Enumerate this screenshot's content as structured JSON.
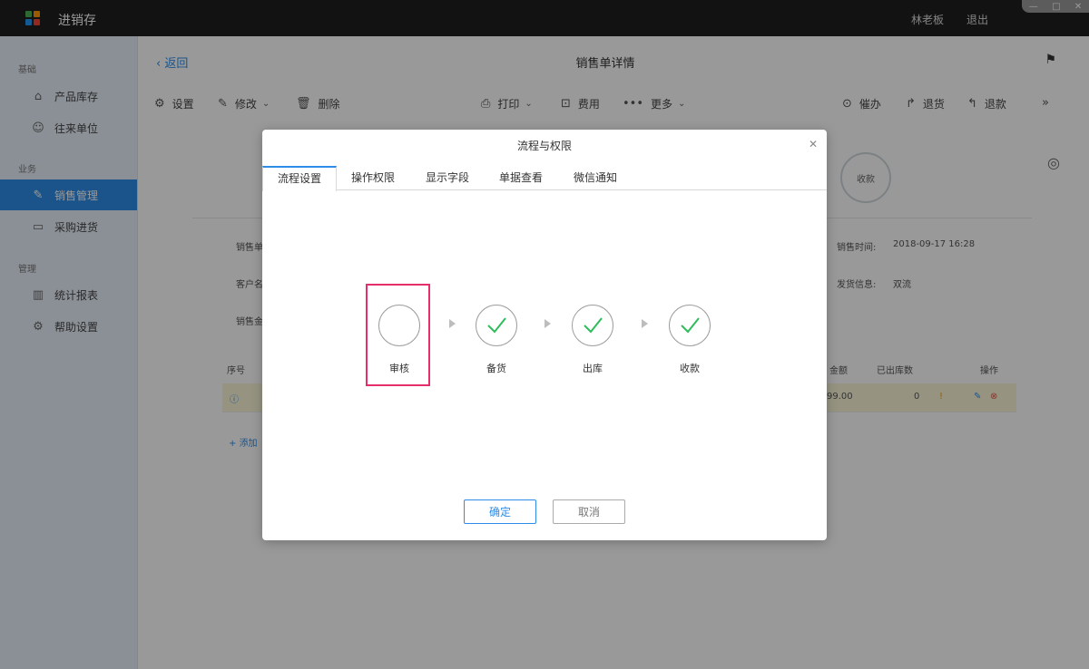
{
  "app": {
    "title": "进销存",
    "user": "林老板",
    "logout": "退出",
    "logo_colors": [
      "#4caf50",
      "#ff9800",
      "#2196f3",
      "#f44336"
    ]
  },
  "sidebar": {
    "sections": [
      {
        "label": "基础",
        "items": [
          {
            "label": "产品库存",
            "icon": "tag-icon"
          },
          {
            "label": "往来单位",
            "icon": "contacts-icon"
          }
        ]
      },
      {
        "label": "业务",
        "items": [
          {
            "label": "销售管理",
            "icon": "edit-icon",
            "active": true
          },
          {
            "label": "采购进货",
            "icon": "inbox-icon"
          }
        ]
      },
      {
        "label": "管理",
        "items": [
          {
            "label": "统计报表",
            "icon": "bar-chart-icon"
          },
          {
            "label": "帮助设置",
            "icon": "gear-icon"
          }
        ]
      }
    ]
  },
  "page": {
    "back": "返回",
    "title": "销售单详情"
  },
  "toolbar": {
    "settings": "设置",
    "edit": "修改",
    "delete": "删除",
    "print": "打印",
    "fee": "费用",
    "more": "更多",
    "urge": "催办",
    "return_goods": "退货",
    "refund": "退款"
  },
  "status": {
    "label": "收款"
  },
  "info": {
    "sale_no_label": "销售单",
    "customer_label": "客户名",
    "sale_amount_label": "销售金",
    "sale_time_label": "销售时间:",
    "sale_time_value": "2018-09-17 16:28",
    "ship_label": "发货信息:",
    "ship_value": "双流"
  },
  "table": {
    "headers": {
      "index": "序号",
      "amount": "金额",
      "shipped": "已出库数",
      "actions": "操作"
    },
    "row": {
      "amount": "99.00",
      "shipped": "0"
    },
    "add": "添加"
  },
  "colors": {
    "accent": "#2c8ce8",
    "highlight": "#e62e6b",
    "check": "#2ebd5a"
  },
  "modal": {
    "title": "流程与权限",
    "tabs": [
      "流程设置",
      "操作权限",
      "显示字段",
      "单据查看",
      "微信通知"
    ],
    "active_tab": 0,
    "steps": [
      {
        "label": "审核",
        "checked": false
      },
      {
        "label": "备货",
        "checked": true
      },
      {
        "label": "出库",
        "checked": true
      },
      {
        "label": "收款",
        "checked": true
      }
    ],
    "ok": "确定",
    "cancel": "取消"
  }
}
